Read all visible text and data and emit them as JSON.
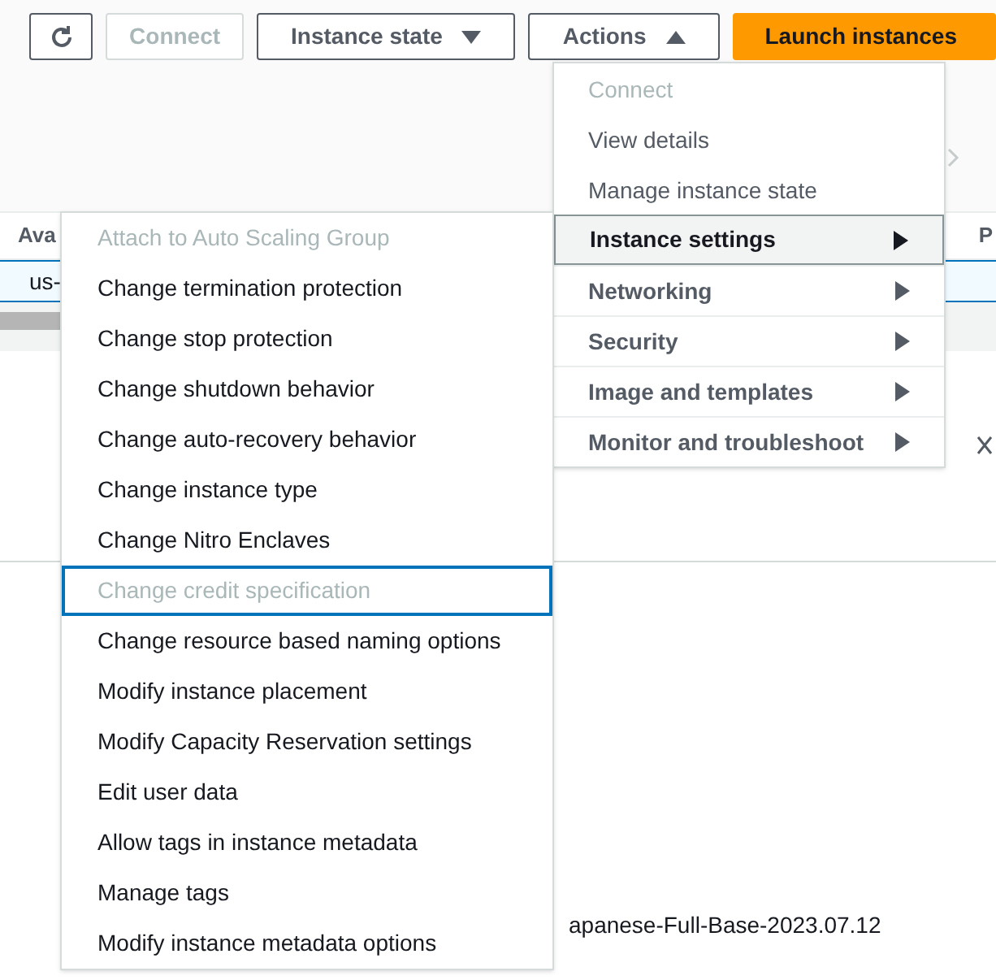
{
  "toolbar": {
    "buttons": [
      {
        "kind": "refresh",
        "disabled": false
      },
      {
        "kind": "button",
        "label": "Connect",
        "disabled": true
      },
      {
        "kind": "dropdown",
        "label": "Instance state",
        "disabled": false,
        "expanded": false
      },
      {
        "kind": "dropdown",
        "label": "Actions",
        "disabled": false,
        "expanded": true
      },
      {
        "kind": "primary",
        "label": "Launch instances",
        "disabled": false
      }
    ]
  },
  "table": {
    "columns": [
      "Ava",
      "P"
    ],
    "rows": [
      {
        "cells": [
          "us-"
        ],
        "selected": true
      }
    ]
  },
  "footer_text": "apanese-Full-Base-2023.07.12",
  "actions_menu": {
    "items": [
      {
        "label": "Connect",
        "kind": "item",
        "disabled": true,
        "selected": false
      },
      {
        "label": "View details",
        "kind": "item",
        "disabled": false,
        "selected": false
      },
      {
        "label": "Manage instance state",
        "kind": "item",
        "disabled": false,
        "selected": false
      },
      {
        "label": "Instance settings",
        "kind": "submenu",
        "disabled": false,
        "selected": true
      },
      {
        "label": "Networking",
        "kind": "submenu",
        "disabled": false,
        "selected": false
      },
      {
        "label": "Security",
        "kind": "submenu",
        "disabled": false,
        "selected": false
      },
      {
        "label": "Image and templates",
        "kind": "submenu",
        "disabled": false,
        "selected": false
      },
      {
        "label": "Monitor and troubleshoot",
        "kind": "submenu",
        "disabled": false,
        "selected": false
      }
    ]
  },
  "submenu": {
    "items": [
      {
        "label": "Attach to Auto Scaling Group",
        "disabled": true,
        "focused": false
      },
      {
        "label": "Change termination protection",
        "disabled": false,
        "focused": false
      },
      {
        "label": "Change stop protection",
        "disabled": false,
        "focused": false
      },
      {
        "label": "Change shutdown behavior",
        "disabled": false,
        "focused": false
      },
      {
        "label": "Change auto-recovery behavior",
        "disabled": false,
        "focused": false
      },
      {
        "label": "Change instance type",
        "disabled": false,
        "focused": false
      },
      {
        "label": "Change Nitro Enclaves",
        "disabled": false,
        "focused": false
      },
      {
        "label": "Change credit specification",
        "disabled": true,
        "focused": true
      },
      {
        "label": "Change resource based naming options",
        "disabled": false,
        "focused": false
      },
      {
        "label": "Modify instance placement",
        "disabled": false,
        "focused": false
      },
      {
        "label": "Modify Capacity Reservation settings",
        "disabled": false,
        "focused": false
      },
      {
        "label": "Edit user data",
        "disabled": false,
        "focused": false
      },
      {
        "label": "Allow tags in instance metadata",
        "disabled": false,
        "focused": false
      },
      {
        "label": "Manage tags",
        "disabled": false,
        "focused": false
      },
      {
        "label": "Modify instance metadata options",
        "disabled": false,
        "focused": false
      }
    ]
  }
}
